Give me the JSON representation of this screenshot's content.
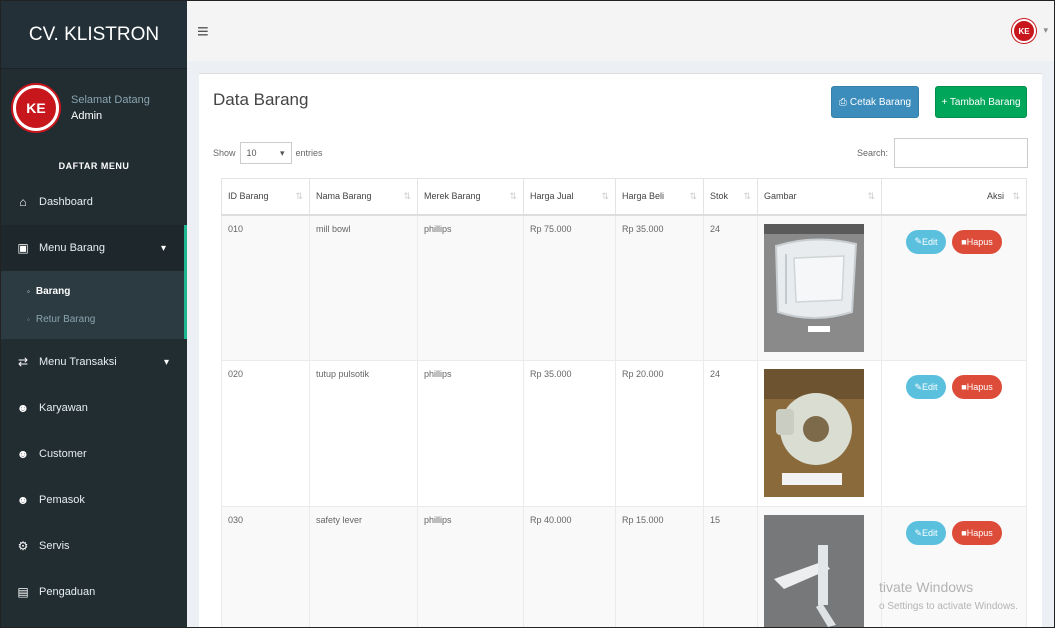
{
  "sidebar": {
    "brand": "CV. KLISTRON",
    "logo_text": "KE",
    "welcome": "Selamat Datang",
    "username": "Admin",
    "menu_header": "DAFTAR MENU",
    "items": [
      {
        "label": "Dashboard",
        "icon": "home-icon"
      },
      {
        "label": "Menu Barang",
        "icon": "cart-icon"
      },
      {
        "label": "Menu Transaksi",
        "icon": "exchange-icon"
      },
      {
        "label": "Karyawan",
        "icon": "users-icon"
      },
      {
        "label": "Customer",
        "icon": "users-icon"
      },
      {
        "label": "Pemasok",
        "icon": "users-icon"
      },
      {
        "label": "Servis",
        "icon": "gear-icon"
      },
      {
        "label": "Pengaduan",
        "icon": "report-icon"
      }
    ],
    "submenu": [
      {
        "label": "Barang"
      },
      {
        "label": "Retur Barang"
      }
    ]
  },
  "topbar": {
    "hamburger": "≡",
    "logo_text": "KE"
  },
  "box": {
    "title": "Data Barang",
    "print_label": "Cetak Barang",
    "add_label": "+ Tambah Barang",
    "show_label": "Show",
    "entries_value": "10",
    "entries_label": "entries",
    "search_label": "Search:"
  },
  "table": {
    "headers": [
      "ID Barang",
      "Nama Barang",
      "Merek Barang",
      "Harga Jual",
      "Harga Beli",
      "Stok",
      "Gambar",
      "Aksi"
    ],
    "rows": [
      {
        "id": "010",
        "nama": "mill bowl",
        "merek": "phillips",
        "jual": "Rp 75.000",
        "beli": "Rp 35.000",
        "stok": "24"
      },
      {
        "id": "020",
        "nama": "tutup pulsotik",
        "merek": "phillips",
        "jual": "Rp 35.000",
        "beli": "Rp 20.000",
        "stok": "24"
      },
      {
        "id": "030",
        "nama": "safety lever",
        "merek": "phillips",
        "jual": "Rp 40.000",
        "beli": "Rp 15.000",
        "stok": "15"
      }
    ],
    "edit_label": "Edit",
    "delete_label": "Hapus"
  },
  "watermark": {
    "line1": "tivate Windows",
    "line2": "o Settings to activate Windows."
  }
}
